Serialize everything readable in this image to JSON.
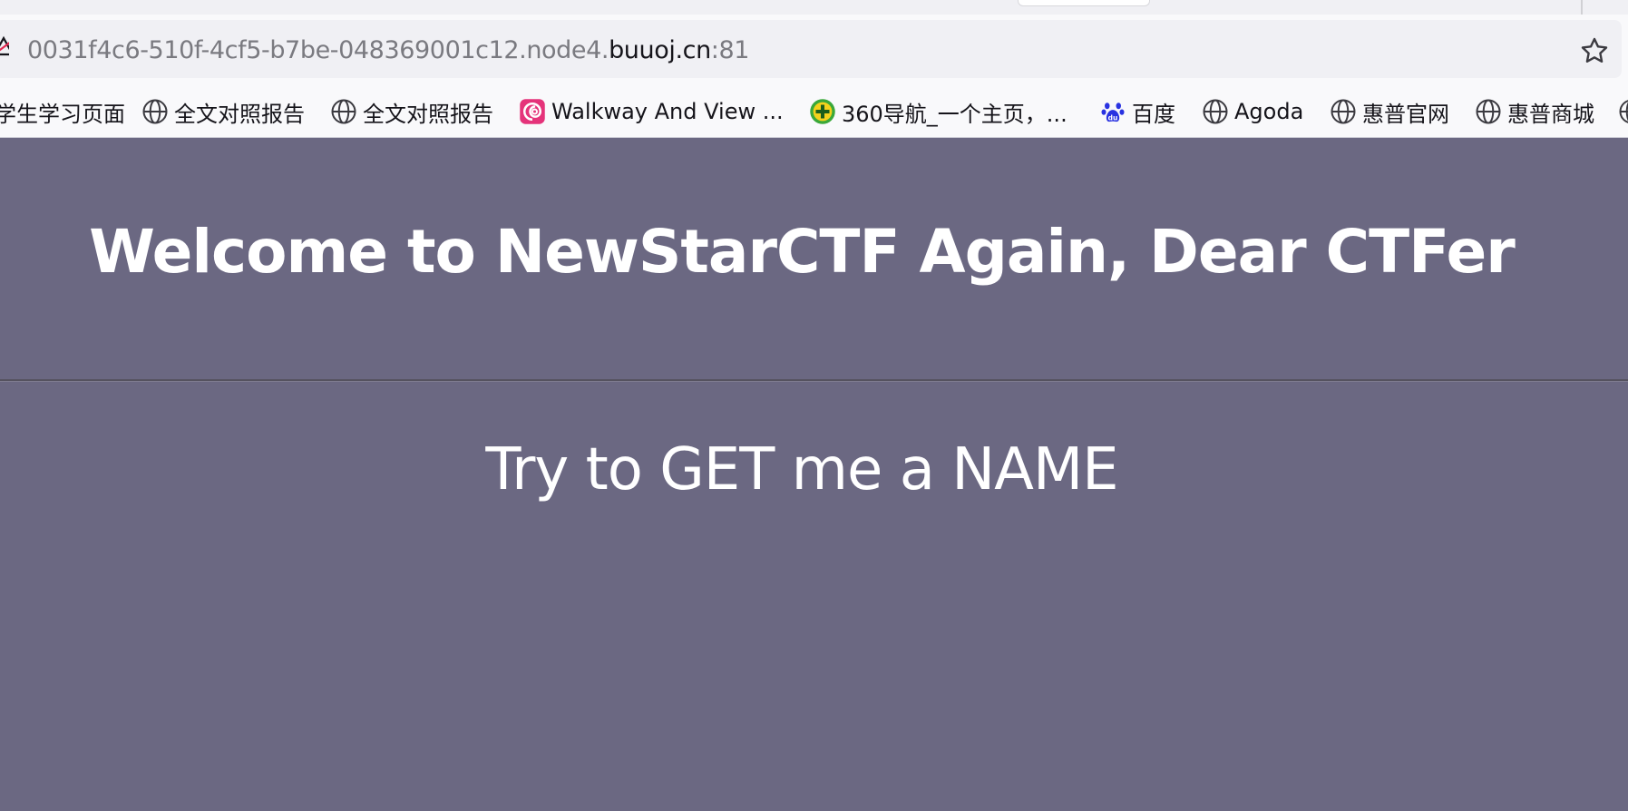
{
  "browser": {
    "url": {
      "prefix": "0031f4c6-510f-4cf5-b7be-048369001c12.node4.",
      "host": "buuoj.cn",
      "suffix": ":81"
    },
    "bookmarks": [
      {
        "label": "学生学习页面",
        "icon": "none"
      },
      {
        "label": "全文对照报告",
        "icon": "globe-icon"
      },
      {
        "label": "全文对照报告",
        "icon": "globe-icon"
      },
      {
        "label": "Walkway And View ...",
        "icon": "swirl-logo-icon"
      },
      {
        "label": "360导航_一个主页，...",
        "icon": "360-logo-icon"
      },
      {
        "label": "百度",
        "icon": "baidu-paw-icon"
      },
      {
        "label": "Agoda",
        "icon": "globe-icon"
      },
      {
        "label": "惠普官网",
        "icon": "globe-icon"
      },
      {
        "label": "惠普商城",
        "icon": "globe-icon"
      }
    ]
  },
  "page": {
    "title": "Welcome to NewStarCTF Again, Dear CTFer",
    "subtitle": "Try to GET me a NAME"
  },
  "colors": {
    "page_background": "#6b6882",
    "text": "#ffffff",
    "swirl_logo": "#e5337a",
    "baidu_logo": "#2932e1",
    "logo_360": "#3aa83a"
  }
}
